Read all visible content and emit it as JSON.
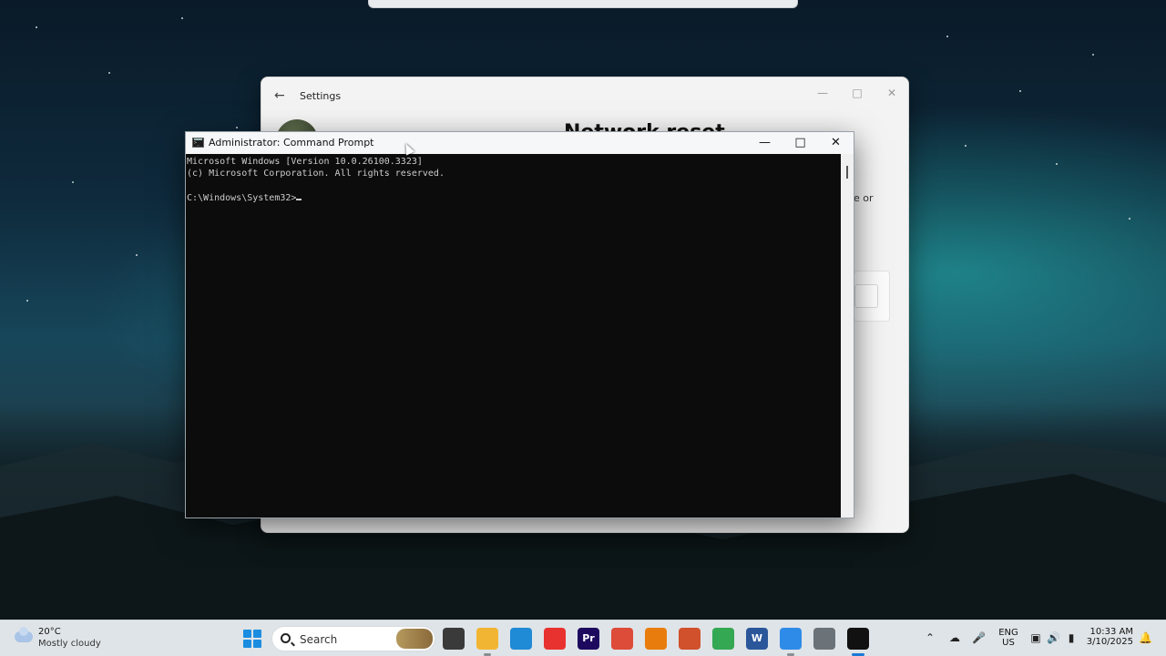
{
  "settings": {
    "title": "Settings",
    "heading": "Network reset",
    "peek_text": "e or"
  },
  "cmd": {
    "title": "Administrator: Command Prompt",
    "lines": [
      "Microsoft Windows [Version 10.0.26100.3323]",
      "(c) Microsoft Corporation. All rights reserved.",
      "",
      "C:\\Windows\\System32>"
    ]
  },
  "taskbar": {
    "weather_temp": "20°C",
    "weather_condition": "Mostly cloudy",
    "search_label": "Search",
    "language_line1": "ENG",
    "language_line2": "US",
    "time": "10:33 AM",
    "date": "3/10/2025",
    "apps": [
      {
        "name": "task-view",
        "icon": "task-view-icon",
        "color": "#3a3a3a"
      },
      {
        "name": "file-explorer",
        "icon": "folder-icon",
        "color": "#f2b533"
      },
      {
        "name": "microsoft-store",
        "icon": "store-icon",
        "color": "#1f8ad6"
      },
      {
        "name": "anydesk",
        "icon": "diamond-icon",
        "color": "#e8322f"
      },
      {
        "name": "premiere-pro",
        "icon": "premiere-icon",
        "color": "#1d0a5e",
        "label": "Pr"
      },
      {
        "name": "chrome",
        "icon": "chrome-icon",
        "color": "#dd4b39"
      },
      {
        "name": "blender",
        "icon": "blender-icon",
        "color": "#e87d0d"
      },
      {
        "name": "matlab",
        "icon": "matlab-icon",
        "color": "#d0512c"
      },
      {
        "name": "chrome-profile",
        "icon": "chrome-icon",
        "color": "#34a853"
      },
      {
        "name": "word",
        "icon": "word-icon",
        "color": "#2b579a",
        "label": "W"
      },
      {
        "name": "snipping-tool",
        "icon": "scissors-icon",
        "color": "#2f8be8"
      },
      {
        "name": "settings",
        "icon": "gear-icon",
        "color": "#6b7278"
      },
      {
        "name": "command-prompt",
        "icon": "terminal-icon",
        "color": "#111111"
      }
    ]
  }
}
